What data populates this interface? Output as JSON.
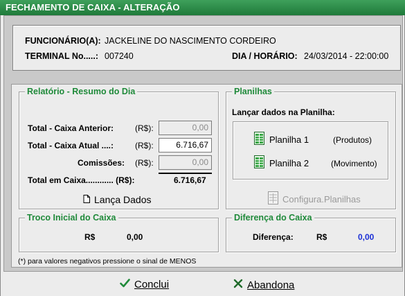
{
  "window": {
    "title": "FECHAMENTO DE CAIXA - ALTERAÇÃO"
  },
  "header": {
    "funcionario_label": "FUNCIONÁRIO(A):",
    "funcionario_value": "JACKELINE DO NASCIMENTO CORDEIRO",
    "terminal_label": "TERMINAL No.....:",
    "terminal_value": "007240",
    "datetime_label": "DIA / HORÁRIO:",
    "datetime_value": "24/03/2014 - 22:00:00"
  },
  "relatorio": {
    "title": "Relatório - Resumo do Dia",
    "caixa_anterior_label": "Total - Caixa  Anterior:",
    "caixa_anterior_currency": "(R$):",
    "caixa_anterior_value": "0,00",
    "caixa_atual_label": "Total - Caixa Atual ....:",
    "caixa_atual_currency": "(R$):",
    "caixa_atual_value": "6.716,67",
    "comissoes_label": "Comissões:",
    "comissoes_currency": "(R$):",
    "comissoes_value": "0,00",
    "total_label": "Total em Caixa............ (R$):",
    "total_value": "6.716,67",
    "lanca_dados_label": "Lança Dados"
  },
  "planilhas": {
    "title": "Planilhas",
    "prompt": "Lançar dados na Planilha:",
    "planilha1_label": "Planilha 1",
    "planilha1_desc": "(Produtos)",
    "planilha2_label": "Planilha 2",
    "planilha2_desc": "(Movimento)",
    "configura_label": "Configura.Planilhas"
  },
  "troco": {
    "title": "Troco Inicial do Caixa",
    "currency": "R$",
    "value": "0,00"
  },
  "diferenca": {
    "title": "Diferença do Caixa",
    "label": "Diferença:",
    "currency": "R$",
    "value": "0,00",
    "value_color": "#1a2fd6"
  },
  "note": "(*) para valores negativos pressione o sinal de MENOS",
  "actions": {
    "concluir_label": "Conclui",
    "abandona_label": "Abandona"
  },
  "icons": {
    "lanca_dados": "document-icon",
    "planilha": "spreadsheet-icon",
    "configura": "spreadsheet-disabled-icon",
    "concluir": "check-icon",
    "abandona": "x-icon"
  },
  "colors": {
    "title_bar": "#2a8a46",
    "group_title": "#1f8a3a",
    "disabled_text": "#9a9a9a"
  }
}
